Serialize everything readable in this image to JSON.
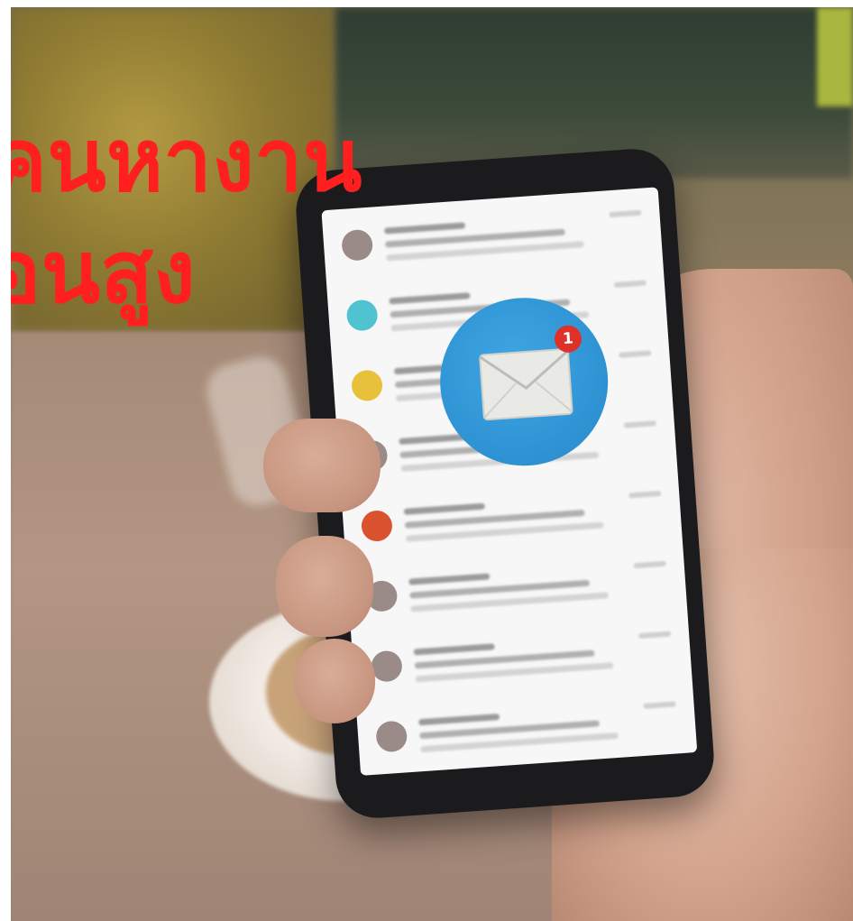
{
  "image": {
    "overlay_text_lines": [
      "คนหางาน",
      "อนสูง"
    ],
    "overlay_text_color": "#ff1f1f"
  },
  "phone": {
    "notification_badge": "1",
    "icon_circle_color": "#2e92d2",
    "contact_dot_colors": [
      "#9a8a88",
      "#4fc3cf",
      "#e8c13a",
      "#9a8a88",
      "#d9532e",
      "#9a8a88",
      "#9a8a88",
      "#9a8a88"
    ]
  },
  "icons": {
    "mail": "envelope-icon",
    "badge": "notification-badge"
  }
}
